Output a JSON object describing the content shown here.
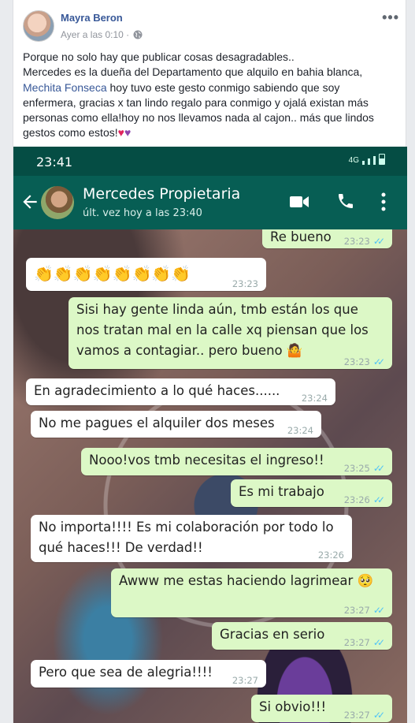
{
  "post": {
    "author": "Mayra Beron",
    "time": "Ayer a las 0:10 ·",
    "text_line1": "Porque no solo hay que publicar cosas desagradables..",
    "text_line2": "Mercedes es la dueña del Departamento que alquilo en bahia blanca,",
    "mention": "Mechita Fonseca",
    "text_line3_rest": " hoy tuvo este gesto conmigo sabiendo que soy",
    "text_line4": "enfermera, gracias x tan lindo regalo para conmigo y ojalá existan más",
    "text_line5": "personas como ella!hoy no nos llevamos nada al cajon.. más que lindos",
    "text_line6": "gestos como estos!",
    "emoji_heart": "♥",
    "emoji_purple_heart": "♥"
  },
  "whatsapp": {
    "status_time": "23:41",
    "network": "4G",
    "contact_name": "Mercedes Propietaria",
    "last_seen": "últ. vez hoy a las 23:40",
    "messages": [
      {
        "dir": "out",
        "text": "Re bueno",
        "time": "23:23"
      },
      {
        "dir": "in",
        "text": "👏👏👏👏👏👏👏👏",
        "time": "23:23"
      },
      {
        "dir": "out",
        "text": "Sisi hay gente linda aún, tmb están los que nos tratan mal en la calle xq piensan que los vamos a contagiar.. pero bueno 🤷",
        "time": "23:23"
      },
      {
        "dir": "in",
        "text": "En agradecimiento a lo qué haces......",
        "time": "23:24"
      },
      {
        "dir": "in",
        "text": "No me pagues el alquiler dos meses",
        "time": "23:24"
      },
      {
        "dir": "out",
        "text": "Nooo!vos tmb necesitas el ingreso!!",
        "time": "23:25"
      },
      {
        "dir": "out",
        "text": "Es mi trabajo",
        "time": "23:26"
      },
      {
        "dir": "in",
        "text": "No importa!!!! Es mi colaboración por todo lo qué haces!!! De verdad!!",
        "time": "23:26"
      },
      {
        "dir": "out",
        "text": "Awww me estas haciendo lagrimear 🥺",
        "time": "23:27"
      },
      {
        "dir": "out",
        "text": "Gracias en serio",
        "time": "23:27"
      },
      {
        "dir": "in",
        "text": "Pero que sea de alegria!!!!",
        "time": "23:27"
      },
      {
        "dir": "out",
        "text": "Si obvio!!!",
        "time": "23:27"
      }
    ]
  }
}
